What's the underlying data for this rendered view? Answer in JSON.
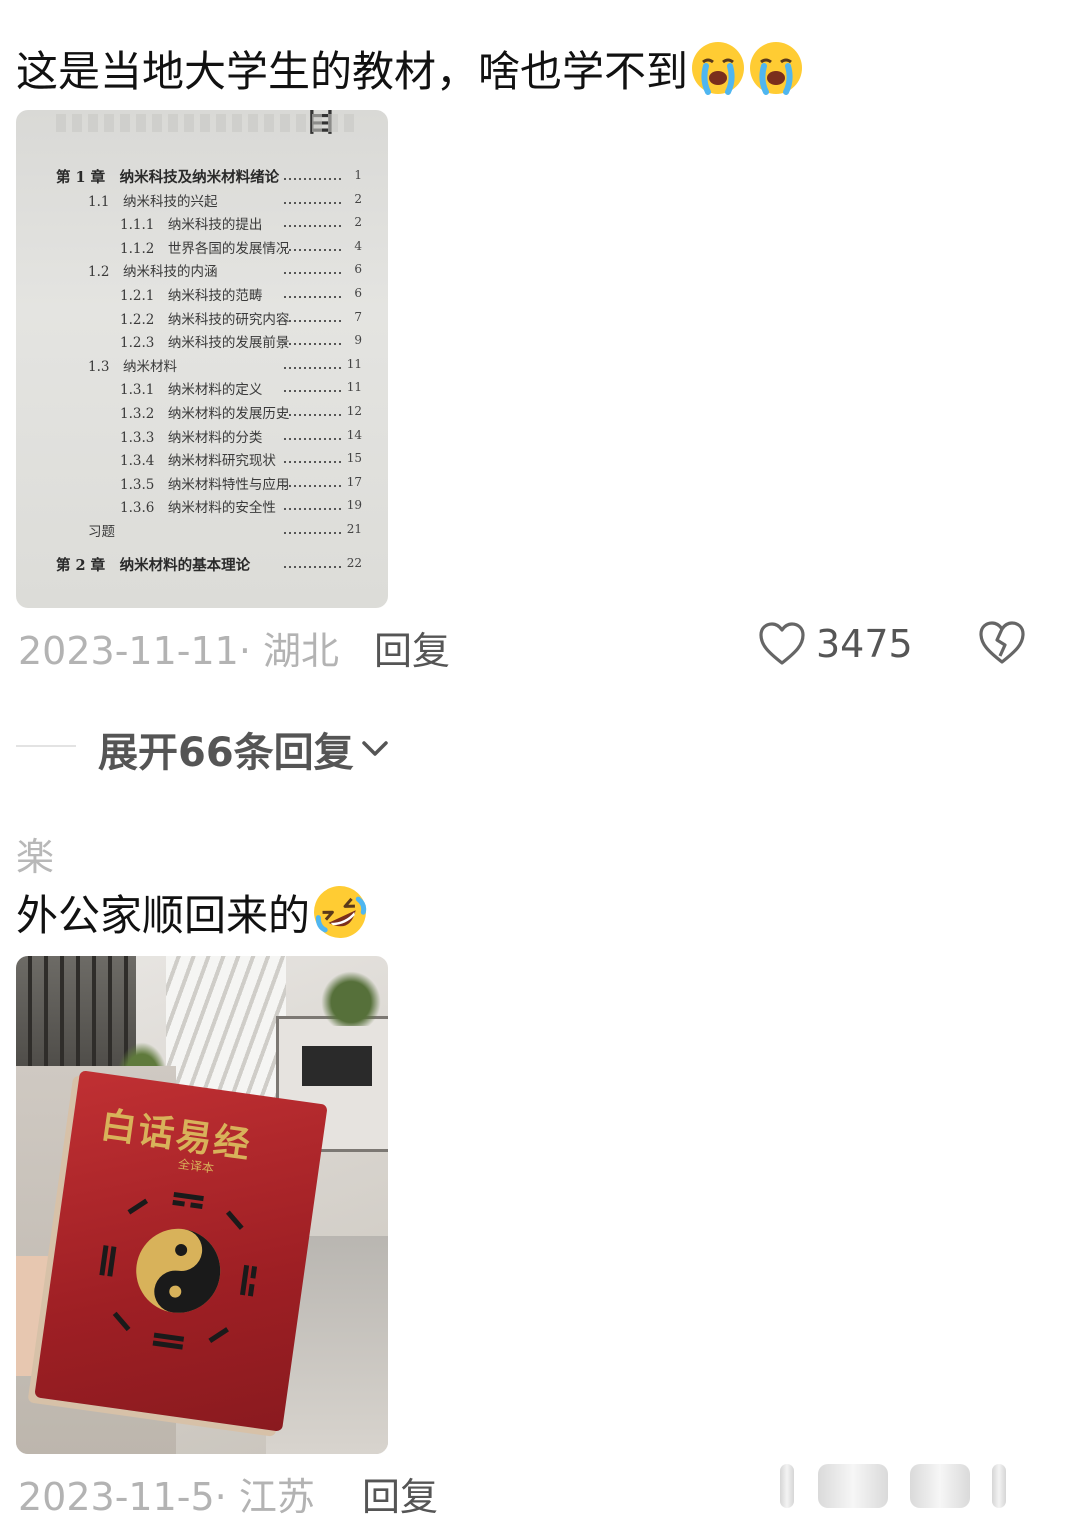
{
  "comment1": {
    "text": "这是当地大学生的教材，啥也学不到",
    "emojis": [
      "crying-face",
      "crying-face"
    ],
    "image": {
      "heading_char": "目",
      "toc": [
        {
          "label": "第 1 章　纳米科技及纳米材料绪论",
          "page": "1",
          "level": 0
        },
        {
          "label": "1.1　纳米科技的兴起",
          "page": "2",
          "level": 1
        },
        {
          "label": "1.1.1　纳米科技的提出",
          "page": "2",
          "level": 2
        },
        {
          "label": "1.1.2　世界各国的发展情况",
          "page": "4",
          "level": 2
        },
        {
          "label": "1.2　纳米科技的内涵",
          "page": "6",
          "level": 1
        },
        {
          "label": "1.2.1　纳米科技的范畴",
          "page": "6",
          "level": 2
        },
        {
          "label": "1.2.2　纳米科技的研究内容",
          "page": "7",
          "level": 2
        },
        {
          "label": "1.2.3　纳米科技的发展前景",
          "page": "9",
          "level": 2
        },
        {
          "label": "1.3　纳米材料",
          "page": "11",
          "level": 1
        },
        {
          "label": "1.3.1　纳米材料的定义",
          "page": "11",
          "level": 2
        },
        {
          "label": "1.3.2　纳米材料的发展历史",
          "page": "12",
          "level": 2
        },
        {
          "label": "1.3.3　纳米材料的分类",
          "page": "14",
          "level": 2
        },
        {
          "label": "1.3.4　纳米材料研究现状",
          "page": "15",
          "level": 2
        },
        {
          "label": "1.3.5　纳米材料特性与应用",
          "page": "17",
          "level": 2
        },
        {
          "label": "1.3.6　纳米材料的安全性",
          "page": "19",
          "level": 2
        },
        {
          "label": "习题",
          "page": "21",
          "level": 1
        },
        {
          "label": "第 2 章　纳米材料的基本理论",
          "page": "22",
          "level": 0
        }
      ]
    },
    "date": "2023-11-11",
    "location": "湖北",
    "reply_label": "回复",
    "like_count": "3475"
  },
  "expand_replies": {
    "label": "展开66条回复"
  },
  "comment2": {
    "username": "楽",
    "text": "外公家顺回来的",
    "emojis": [
      "rolling-laughing-face"
    ],
    "image": {
      "book_title": "白话易经",
      "book_subtitle": "全译本"
    },
    "date": "2023-11-5",
    "location": "江苏",
    "reply_label": "回复"
  },
  "colors": {
    "meta_gray": "#b3b3b3",
    "text_dark": "#111111",
    "book_red": "#b3262a",
    "book_gold": "#d8b25a"
  }
}
